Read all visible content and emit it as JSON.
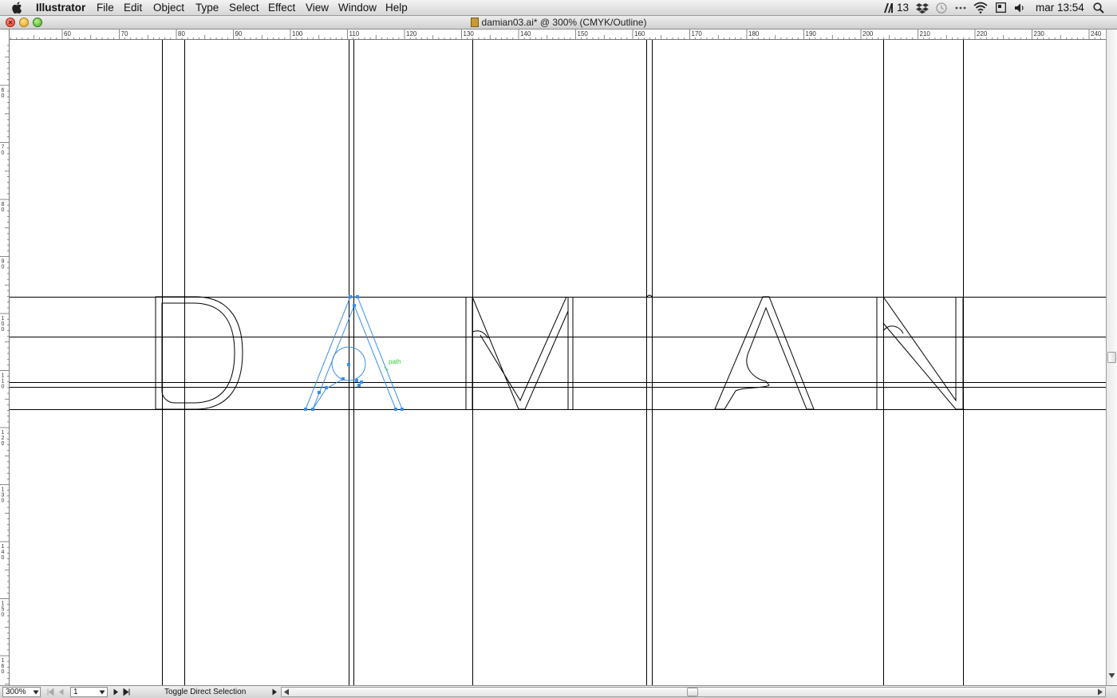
{
  "menubar": {
    "app_name": "Illustrator",
    "items": [
      "File",
      "Edit",
      "Object",
      "Type",
      "Select",
      "Effect",
      "View",
      "Window",
      "Help"
    ],
    "status": {
      "adobe_count": "13",
      "clock": "mar 13:54"
    }
  },
  "window": {
    "title": "damian03.ai* @ 300% (CMYK/Outline)"
  },
  "rulers": {
    "horizontal_labels": [
      "60",
      "70",
      "80",
      "90",
      "100",
      "110",
      "120",
      "130",
      "140",
      "150",
      "160",
      "170",
      "180",
      "190",
      "200",
      "210",
      "220",
      "230",
      "240"
    ],
    "vertical_labels": [
      "60",
      "70",
      "80",
      "90",
      "100",
      "110",
      "120",
      "130",
      "140",
      "150",
      "160"
    ]
  },
  "canvas": {
    "artwork_text": "DAMIAN",
    "selection_label": "path"
  },
  "statusbar": {
    "zoom": "300%",
    "artboard": "1",
    "status_text": "Toggle Direct Selection"
  },
  "colors": {
    "selection": "#3a8ee6",
    "smart_guide": "#33cc33",
    "outline": "#000000"
  }
}
